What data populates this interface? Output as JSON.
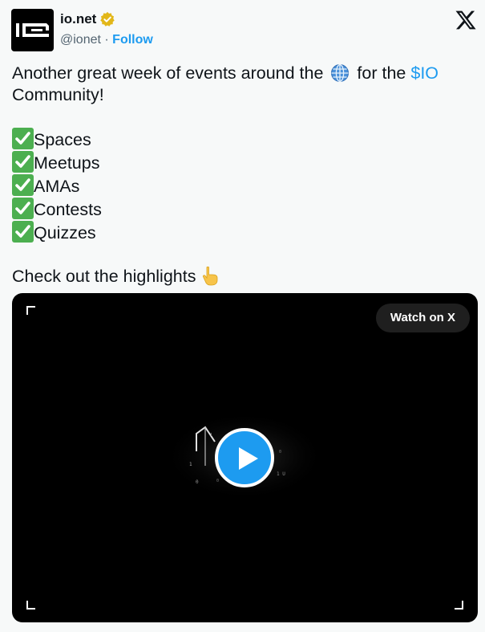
{
  "author": {
    "name": "io.net",
    "handle": "@ionet",
    "separator": "·",
    "follow_label": "Follow"
  },
  "tweet": {
    "line1_before": "Another great week of events around the",
    "line1_middle": "for the",
    "cashtag": "$IO",
    "line2": "Community!",
    "list": [
      "Spaces",
      "Meetups",
      "AMAs",
      "Contests",
      "Quizzes"
    ],
    "closing": "Check out the highlights"
  },
  "video": {
    "watch_label": "Watch on X"
  },
  "icons": {
    "verified": "verified-badge-icon",
    "x_logo": "x-logo-icon",
    "globe": "globe-icon",
    "check": "check-mark-icon",
    "hand": "pointing-down-icon",
    "play": "play-icon"
  },
  "colors": {
    "link": "#1d9bf0",
    "verified_gold": "#e2b719",
    "check_green": "#4caf50",
    "video_bg": "#000000"
  }
}
